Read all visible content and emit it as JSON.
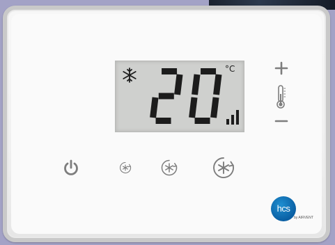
{
  "display": {
    "temperature": "20",
    "unit": "°C",
    "mode_icon": "snowflake-icon",
    "signal_icon": "signal-bars-icon"
  },
  "controls": {
    "increase_icon": "plus-icon",
    "indicator_icon": "thermometer-icon",
    "decrease_icon": "minus-icon",
    "power_icon": "power-icon",
    "fan_speeds": [
      "fan-low-icon",
      "fan-medium-icon",
      "fan-high-icon"
    ]
  },
  "brand": {
    "logo": "hcs",
    "tagline": "by AIRVENT"
  },
  "colors": {
    "lcd_background": "#cfd0ce",
    "segment": "#1c1c1c",
    "icon_gray": "#7d7d7d",
    "logo_blue": "#0a5fa3"
  }
}
